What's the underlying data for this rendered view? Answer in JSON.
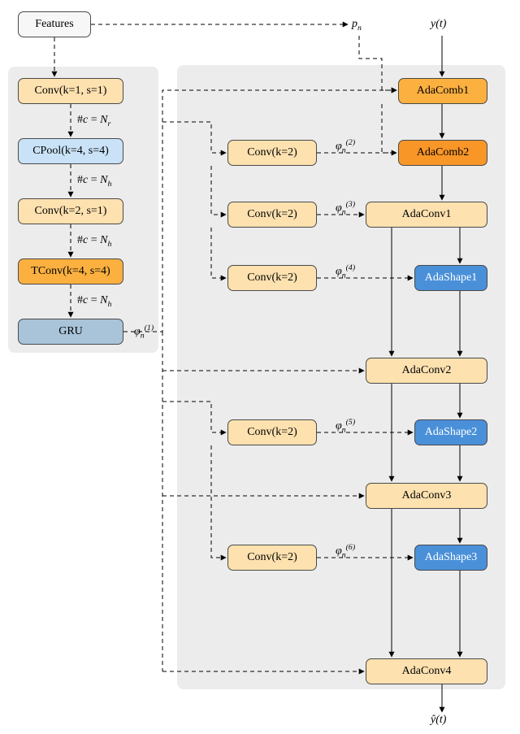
{
  "inputs": {
    "features_label": "Features",
    "y_label": "y(t)",
    "yhat_label": "ŷ(t)",
    "pn_label": "pₙ"
  },
  "left_stack": {
    "conv1": "Conv(k=1, s=1)",
    "cpool": "CPool(k=4, s=4)",
    "conv2": "Conv(k=2, s=1)",
    "tconv": "TConv(k=4, s=4)",
    "gru": "GRU",
    "edge1": "#c = N_r",
    "edge2": "#c = N_h",
    "edge3": "#c = N_h",
    "edge4": "#c = N_h"
  },
  "phi_labels": {
    "phi1": "φₙ⁽¹⁾",
    "phi2": "φₙ⁽²⁾",
    "phi3": "φₙ⁽³⁾",
    "phi4": "φₙ⁽⁴⁾",
    "phi5": "φₙ⁽⁵⁾",
    "phi6": "φₙ⁽⁶⁾"
  },
  "right_stack": {
    "adacomb1": "AdaComb1",
    "adacomb2": "AdaComb2",
    "adaconv1": "AdaConv1",
    "adashape1": "AdaShape1",
    "adaconv2": "AdaConv2",
    "adashape2": "AdaShape2",
    "adaconv3": "AdaConv3",
    "adashape3": "AdaShape3",
    "adaconv4": "AdaConv4"
  },
  "mid_convs": {
    "c2a": "Conv(k=2)",
    "c2b": "Conv(k=2)",
    "c2c": "Conv(k=2)",
    "c2d": "Conv(k=2)",
    "c2e": "Conv(k=2)"
  }
}
